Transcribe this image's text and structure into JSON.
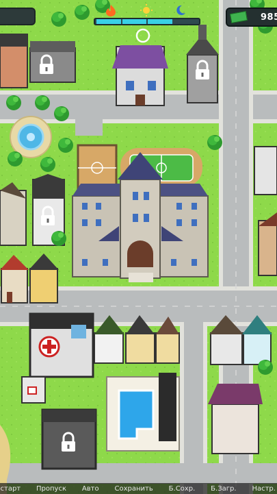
{
  "hud": {
    "money": "985",
    "daynight_icons": [
      "fire-icon",
      "sun-icon",
      "moon-icon"
    ],
    "day_progress_segments": 4,
    "day_progress_filled": 3
  },
  "bottom_menu": [
    {
      "id": "restart",
      "label": "рестарт"
    },
    {
      "id": "skip",
      "label": "Пропуск"
    },
    {
      "id": "auto",
      "label": "Авто"
    },
    {
      "id": "save",
      "label": "Сохранить"
    },
    {
      "id": "quicksave",
      "label": "Б.Сохр."
    },
    {
      "id": "quickload",
      "label": "Б.Загр."
    },
    {
      "id": "settings",
      "label": "Настр."
    }
  ],
  "colors": {
    "grass": "#8ed94a",
    "road": "#b9bcbd",
    "sidewalk": "#e2e2dc",
    "hud_cyan": "#39d0e6",
    "lock": "#ffffff"
  }
}
